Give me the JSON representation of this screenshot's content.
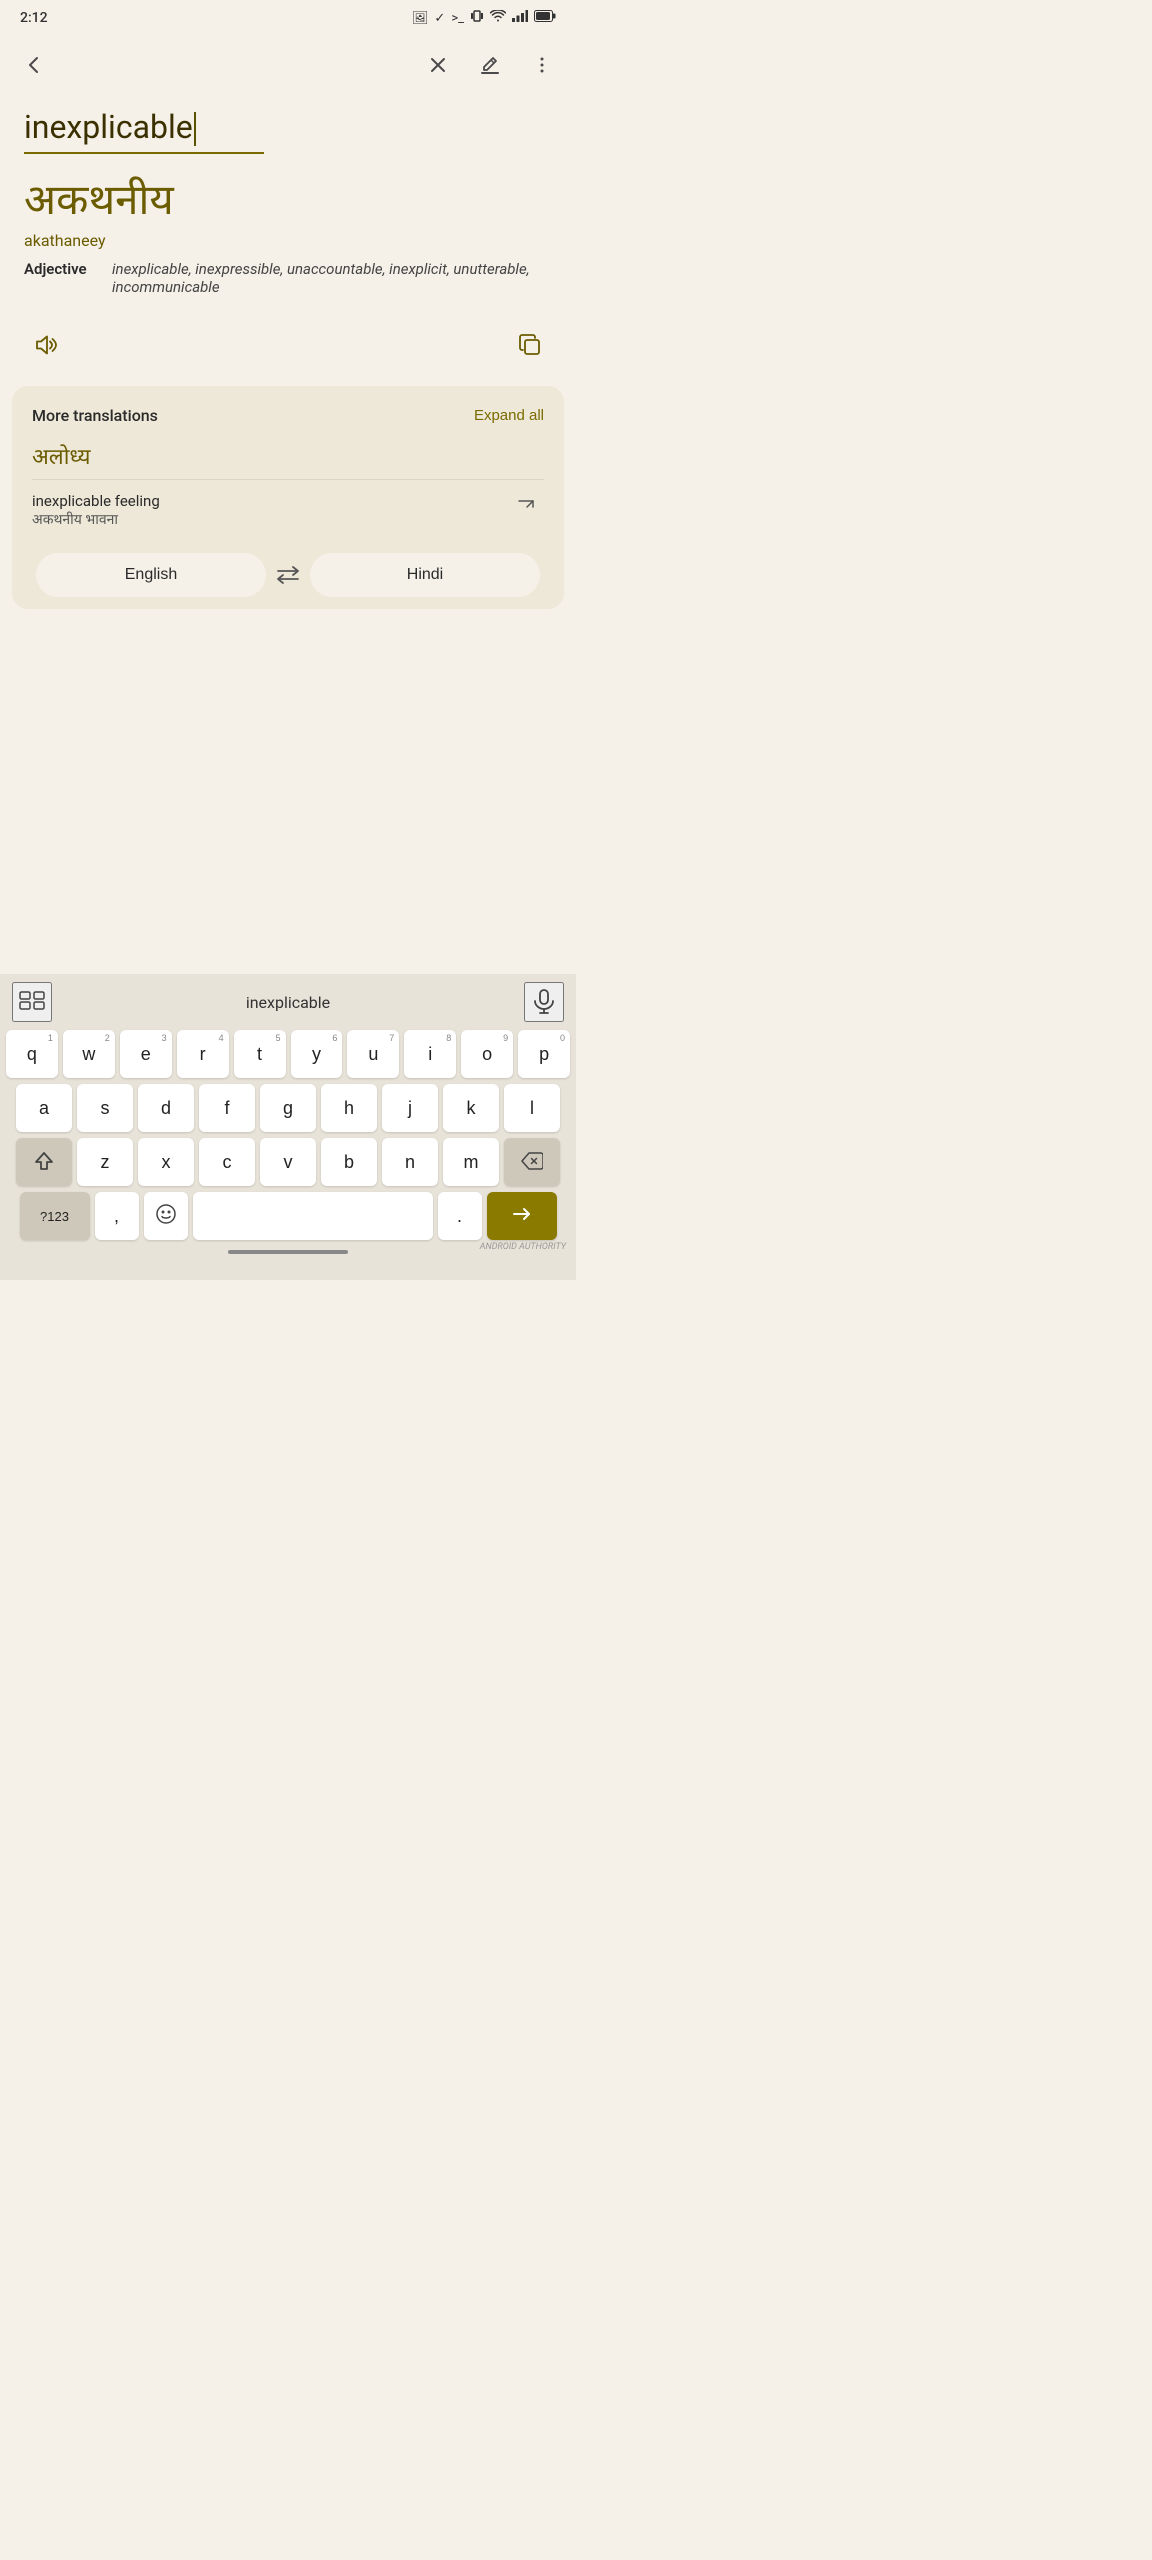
{
  "status": {
    "time": "2:12",
    "icons": [
      "photo",
      "check",
      "terminal",
      "vibrate",
      "wifi",
      "signal",
      "battery"
    ]
  },
  "nav": {
    "back_label": "←",
    "close_label": "×",
    "annotate_label": "✎",
    "more_label": "⋮"
  },
  "input": {
    "text": "inexplicable"
  },
  "translation": {
    "hindi_text": "अकथनीय",
    "romanized": "akathaneey",
    "word_type": "Adjective",
    "synonyms": "inexplicable, inexpressible, unaccountable, inexplicit, unutterable, incommunicable"
  },
  "more_translations": {
    "title": "More translations",
    "expand_label": "Expand all",
    "alt_hindi": "अलोध्य",
    "phrase": {
      "english": "inexplicable feeling",
      "hindi": "अकथनीय भावना"
    }
  },
  "lang_switch": {
    "source_lang": "English",
    "switch_icon": "⇄",
    "target_lang": "Hindi"
  },
  "keyboard": {
    "input_text": "inexplicable",
    "rows": [
      [
        "q",
        "w",
        "e",
        "r",
        "t",
        "y",
        "u",
        "i",
        "o",
        "p"
      ],
      [
        "a",
        "s",
        "d",
        "f",
        "g",
        "h",
        "j",
        "k",
        "l"
      ],
      [
        "z",
        "x",
        "c",
        "v",
        "b",
        "n",
        "m"
      ]
    ],
    "numbers": [
      "1",
      "2",
      "3",
      "4",
      "5",
      "6",
      "7",
      "8",
      "9",
      "0"
    ],
    "shift_label": "⇧",
    "backspace_label": "⌫",
    "symbols_label": "?123",
    "comma_label": ",",
    "emoji_label": "☺",
    "space_label": "",
    "period_label": ".",
    "enter_label": "→"
  }
}
